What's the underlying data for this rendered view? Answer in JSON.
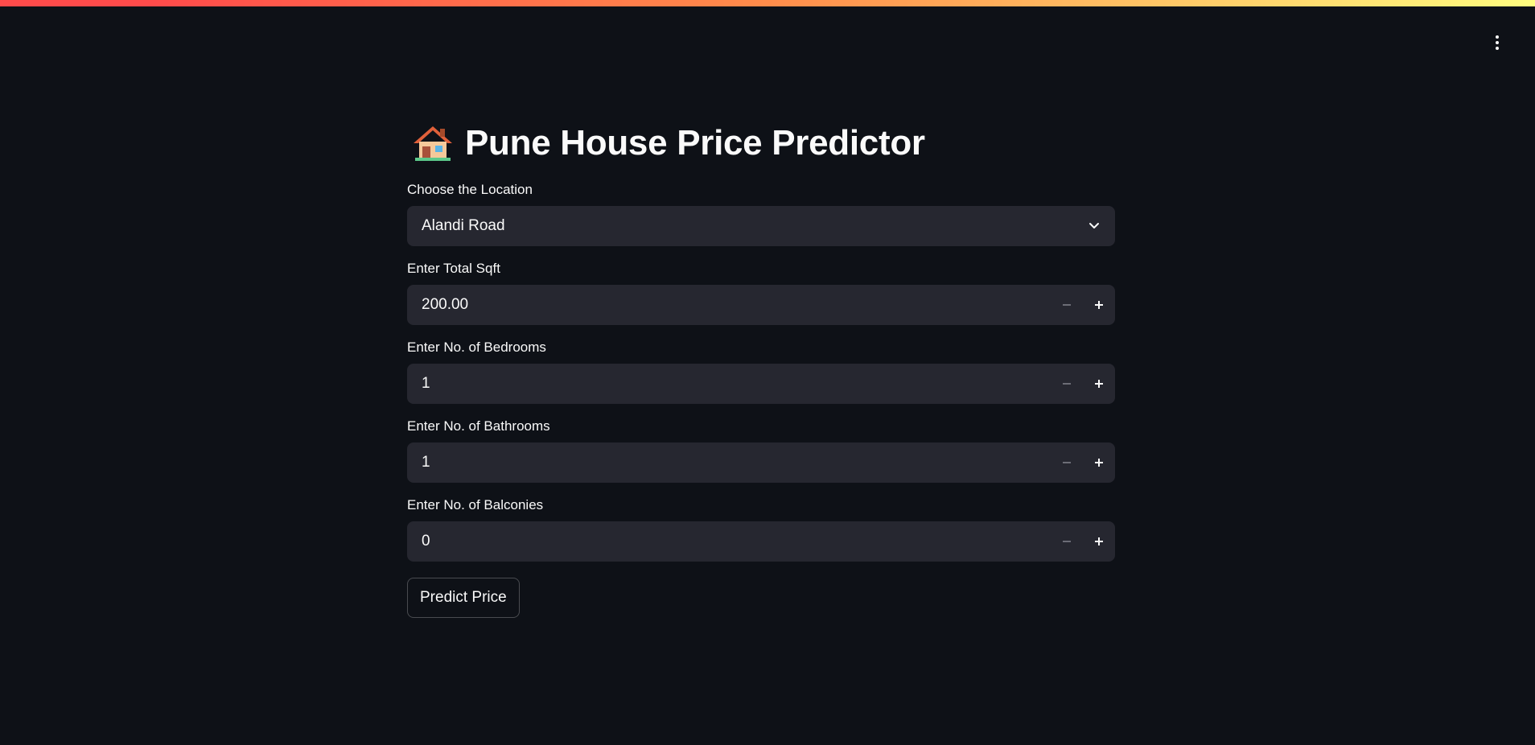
{
  "app": {
    "title_icon": "house-icon",
    "title": "Pune House Price Predictor"
  },
  "header": {
    "menu_icon": "more-vertical-icon"
  },
  "form": {
    "location": {
      "label": "Choose the Location",
      "value": "Alandi Road",
      "icon": "chevron-down-icon"
    },
    "sqft": {
      "label": "Enter Total Sqft",
      "value": "200.00"
    },
    "bedrooms": {
      "label": "Enter No. of Bedrooms",
      "value": "1"
    },
    "bathrooms": {
      "label": "Enter No. of Bathrooms",
      "value": "1"
    },
    "balconies": {
      "label": "Enter No. of Balconies",
      "value": "0"
    },
    "submit_label": "Predict Price"
  },
  "colors": {
    "background": "#0e1117",
    "input_bg": "#262730",
    "text": "#fafafa",
    "accent_red": "#ff4b4b",
    "accent_yellow": "#fffd80"
  }
}
